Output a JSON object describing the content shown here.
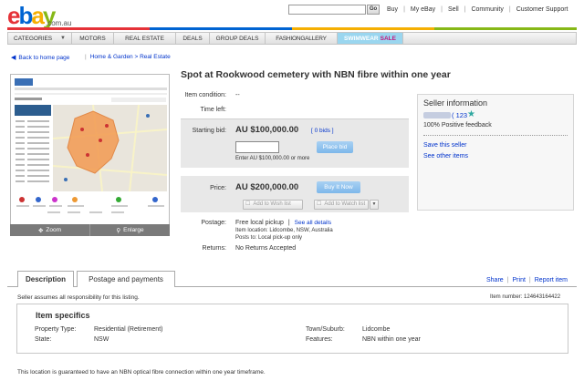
{
  "colors": {
    "link": "#0033cc",
    "ebay_red": "#e53238",
    "ebay_blue": "#0064d2",
    "ebay_yellow": "#f5af02",
    "ebay_green": "#86b817",
    "buy_button": "#7db7ea",
    "star": "#2fa8a0"
  },
  "header": {
    "logo_letters": [
      "e",
      "b",
      "a",
      "y"
    ],
    "logo_tld": ".com.au",
    "search_value": "",
    "go_label": "Go",
    "nav": [
      "Buy",
      "My eBay",
      "Sell",
      "Community",
      "Customer Support"
    ]
  },
  "categories": {
    "first": "CATEGORIES",
    "items": [
      "MOTORS",
      "REAL ESTATE",
      "DEALS",
      "GROUP DEALS",
      "FASHIONGALLERY"
    ],
    "swimwear": "SWIMWEAR",
    "swimwear_sale": "SALE"
  },
  "breadcrumb": {
    "back": "Back to home page",
    "path": "Home & Garden > Real Estate"
  },
  "image": {
    "zoom_label": "Zoom",
    "enlarge_label": "Enlarge"
  },
  "listing": {
    "title": "Spot at Rookwood cemetery with NBN fibre within one year",
    "condition_label": "Item condition:",
    "condition_value": "--",
    "time_left_label": "Time left:",
    "starting_bid_label": "Starting bid:",
    "starting_bid_value": "AU $100,000.00",
    "bids_link": "[ 0 bids ]",
    "place_bid": "Place bid",
    "bid_hint": "Enter AU $100,000.00 or more",
    "price_label": "Price:",
    "price_value": "AU $200,000.00",
    "buy_it_now": "Buy It Now",
    "add_wishlist": "Add to Wish list",
    "add_watchlist": "Add to Watch list",
    "postage_label": "Postage:",
    "postage_value": "Free local pickup",
    "see_details": "See all details",
    "item_location": "Item location: Lidcombe, NSW, Australia",
    "posts_to": "Posts to: Local pick-up only",
    "returns_label": "Returns:",
    "returns_value": "No Returns Accepted"
  },
  "seller": {
    "heading": "Seller information",
    "feedback_count": "( 123",
    "feedback_pct": "100% Positive feedback",
    "save_seller": "Save this seller",
    "other_items": "See other items"
  },
  "tabs": {
    "description": "Description",
    "postage": "Postage and payments",
    "share": "Share",
    "print": "Print",
    "report": "Report item"
  },
  "description": {
    "responsibility": "Seller assumes all responsibility for this listing.",
    "item_number": "Item number: 124643164422",
    "specifics_heading": "Item specifics",
    "specifics": [
      {
        "label": "Property Type:",
        "value": "Residential (Retirement)"
      },
      {
        "label": "State:",
        "value": "NSW"
      },
      {
        "label": "Town/Suburb:",
        "value": "Lidcombe"
      },
      {
        "label": "Features:",
        "value": "NBN within one year"
      }
    ],
    "body": "This location is guaranteed to have an NBN optical fibre connection within one year timeframe."
  }
}
